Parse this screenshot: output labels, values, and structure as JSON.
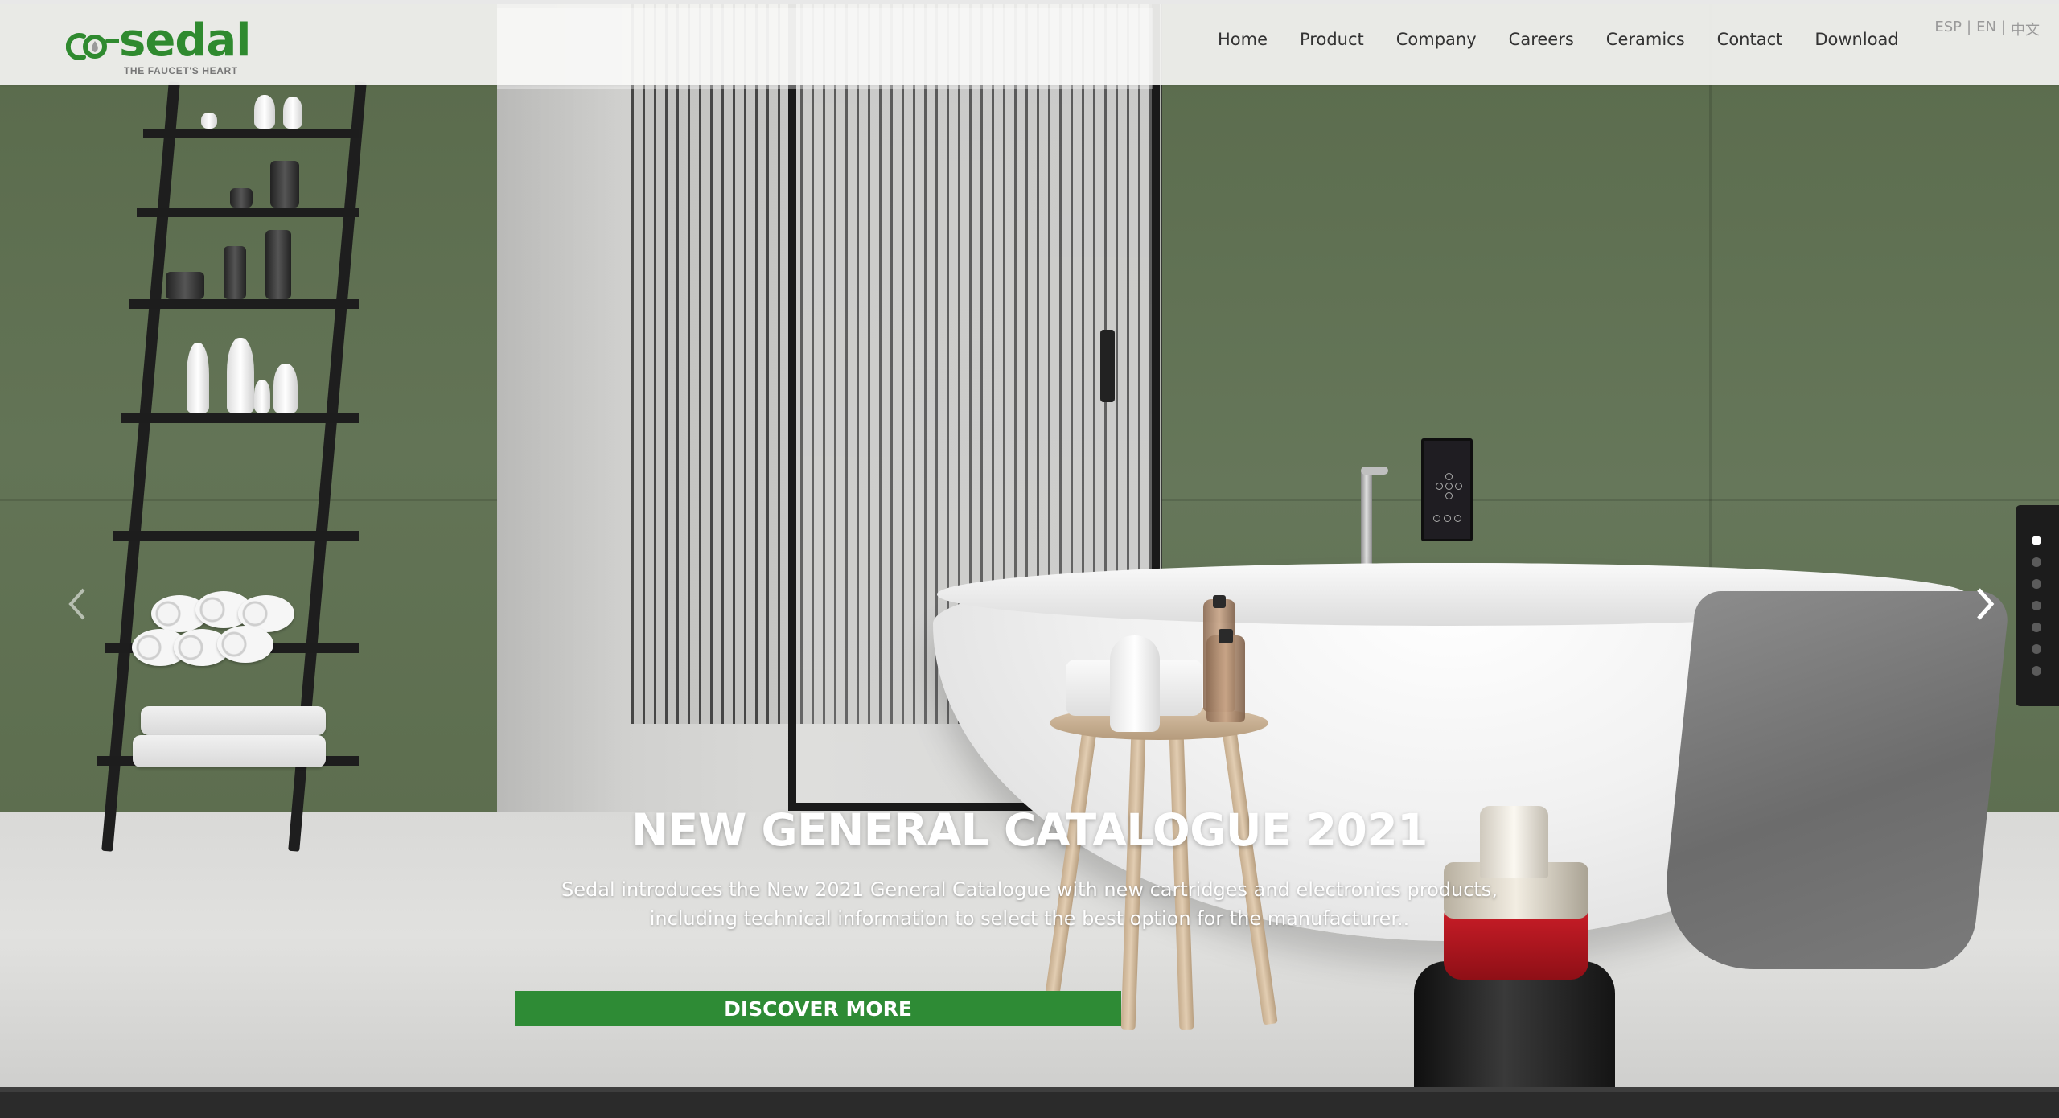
{
  "header": {
    "logo": {
      "text": "sedal",
      "tagline": "THE FAUCET'S HEART",
      "brand_color": "#2f8a2f"
    },
    "nav": [
      {
        "label": "Home"
      },
      {
        "label": "Product"
      },
      {
        "label": "Company"
      },
      {
        "label": "Careers"
      },
      {
        "label": "Ceramics"
      },
      {
        "label": "Contact"
      },
      {
        "label": "Download"
      }
    ],
    "languages": {
      "esp": "ESP",
      "en": "EN",
      "zh": "中文",
      "separator": "|"
    }
  },
  "slider": {
    "title": "NEW GENERAL CATALOGUE 2021",
    "description": "Sedal introduces the New 2021 General Catalogue with new cartridges and electronics products, including technical information to select the best option for the manufacturer..",
    "cta_label": "DISCOVER MORE",
    "cta_color": "#2e8b35",
    "prev_icon": "chevron-left-icon",
    "next_icon": "chevron-right-icon",
    "slide_count": 7,
    "active_slide": 1
  }
}
